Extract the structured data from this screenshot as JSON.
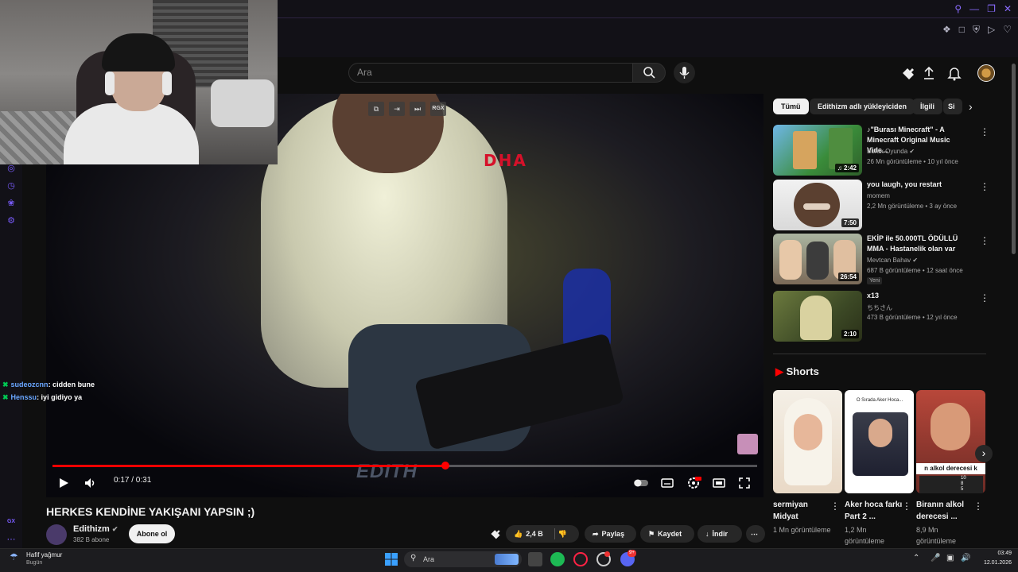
{
  "search": {
    "placeholder": "Ara"
  },
  "player": {
    "overlay_label": "RGX",
    "watermark_logo": "DHA",
    "edit_watermark": "EDITH",
    "time": "0:17 / 0:31",
    "progress_fraction": 0.558
  },
  "chat": [
    {
      "user": "sudeozcnn",
      "message": ": cidden bune"
    },
    {
      "user": "Henssu",
      "message": ": iyi gidiyo ya"
    }
  ],
  "opera_sidebar": {
    "label": "GX"
  },
  "video": {
    "title": "HERKES KENDİNE YAKIŞANI YAPSIN ;)",
    "channel": "Edithizm",
    "subscribers": "382 B abone",
    "subscribe_label": "Abone ol",
    "likes": "2,4 B",
    "share_label": "Paylaş",
    "save_label": "Kaydet",
    "download_label": "İndir"
  },
  "chips": [
    {
      "label": "Tümü",
      "active": true
    },
    {
      "label": "Edithizm adlı yükleyiciden"
    },
    {
      "label": "İlgili"
    },
    {
      "label": "Si"
    }
  ],
  "recommendations": [
    {
      "title": "♪\"Burası Minecraft\" - A Minecraft Original Music Vide...",
      "channel": "Burak Oyunda",
      "meta": "26 Mn görüntüleme • 10 yıl önce",
      "duration": "2:42",
      "icon": "music-note-icon"
    },
    {
      "title": "you laugh, you restart",
      "channel": "momem",
      "meta": "2,2 Mn görüntüleme • 3 ay önce",
      "duration": "7:50"
    },
    {
      "title": "EKİP ile 50.000TL ÖDÜLLÜ MMA - Hastanelik olan var",
      "channel": "Mevtcan Bahav",
      "meta": "687 B görüntüleme • 12 saat önce",
      "duration": "26:54",
      "badge": "Yeni"
    },
    {
      "title": "x13",
      "channel": "ちちさん",
      "meta": "473 B görüntüleme • 12 yıl önce",
      "duration": "2:10"
    }
  ],
  "shorts": {
    "header": "Shorts",
    "items": [
      {
        "title": "sermiyan Midyat",
        "views": "1 Mn görüntüleme"
      },
      {
        "title": "Aker hoca farkı Part 2 ...",
        "views": "1,2 Mn görüntüleme",
        "overlay_text": "O Sırada Aker Hoca..."
      },
      {
        "title": "Biranın alkol derecesi ...",
        "views": "8,9 Mn görüntüleme",
        "overlay_text": "n alkol derecesi k",
        "values": [
          "10",
          "8",
          "5"
        ]
      }
    ]
  },
  "taskbar": {
    "weather_title": "Hafif yağmur",
    "weather_sub": "Bugün",
    "search": "Ara",
    "time": "03:49",
    "date": "12.01.2026",
    "badges": [
      "9+"
    ]
  },
  "colors": {
    "accent": "#ff0000",
    "opera": "#7a5cff"
  }
}
